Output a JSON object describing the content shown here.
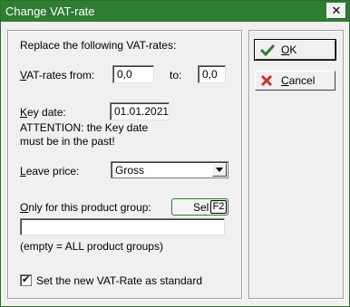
{
  "window": {
    "title": "Change VAT-rate",
    "close_glyph": "✕"
  },
  "form": {
    "heading": "Replace the following VAT-rates:",
    "vat_from_label": "VAT-rates from:",
    "vat_from_value": "0,0",
    "to_label": "to:",
    "vat_to_value": "0,0",
    "key_date_label": "Key date:",
    "key_date_value": "01.01.2021",
    "attention_line1": "ATTENTION: the Key date",
    "attention_line2": "must be in the past!",
    "leave_price_label": "Leave price:",
    "leave_price_value": "Gross",
    "product_group_label": "Only for this product group:",
    "sel_label": "Sel",
    "sel_key": "F2",
    "product_group_value": "",
    "empty_note": "(empty = ALL product groups)",
    "set_standard_label": "Set the new VAT-Rate as standard",
    "set_standard_checked": "✔"
  },
  "buttons": {
    "ok": "OK",
    "cancel": "Cancel"
  },
  "colors": {
    "titlebar": "#2f7d32",
    "ok_check": "#2f7d32",
    "cancel_x": "#d32f2f"
  },
  "icons": {
    "ok": "check-icon",
    "cancel": "x-icon",
    "close": "close-icon",
    "dropdown": "chevron-down-icon"
  }
}
